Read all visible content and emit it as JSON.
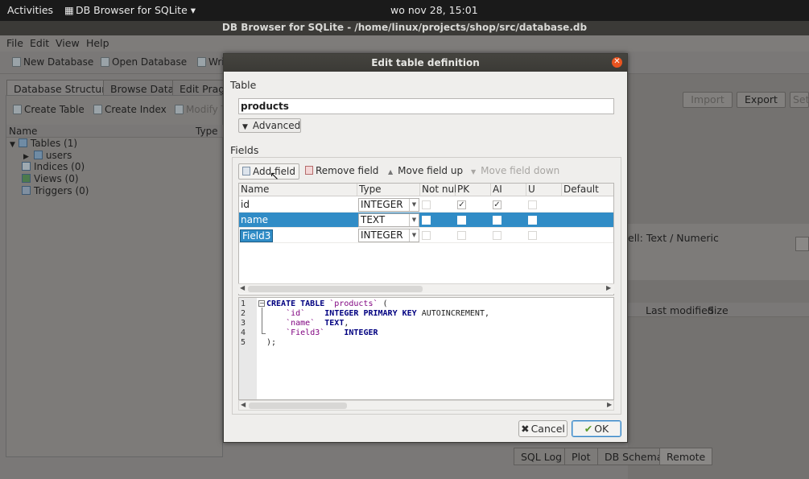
{
  "topbar": {
    "activities": "Activities",
    "app_menu": "DB Browser for SQLite ▾",
    "clock": "wo nov 28, 15:01"
  },
  "window": {
    "title": "DB Browser for SQLite - /home/linux/projects/shop/src/database.db"
  },
  "menubar": {
    "file": "File",
    "edit": "Edit",
    "view": "View",
    "help": "Help"
  },
  "toolbar": {
    "new_db": "New Database",
    "open_db": "Open Database",
    "write": "Wri"
  },
  "main_tabs": {
    "db_structure": "Database Structure",
    "browse_data": "Browse Data",
    "edit_pragmas": "Edit Pragm"
  },
  "left_actions": {
    "create_table": "Create Table",
    "create_index": "Create Index",
    "modify": "Modify T"
  },
  "tree": {
    "col_name": "Name",
    "col_type": "Type",
    "tables": "Tables (1)",
    "users": "users",
    "indices": "Indices (0)",
    "views": "Views (0)",
    "triggers": "Triggers (0)"
  },
  "right": {
    "import": "Import",
    "export": "Export",
    "set": "Set",
    "cell_mode": "ell: Text / Numeric",
    "last_modified": "Last modified",
    "size": "Size",
    "bottom_tabs": [
      "SQL Log",
      "Plot",
      "DB Schema",
      "Remote"
    ]
  },
  "dialog": {
    "title": "Edit table definition",
    "table_label": "Table",
    "table_name": "products",
    "advanced": "Advanced",
    "fields_label": "Fields",
    "add_field": "Add field",
    "remove_field": "Remove field",
    "move_up": "Move field up",
    "move_down": "Move field down",
    "columns": [
      "Name",
      "Type",
      "Not null",
      "PK",
      "AI",
      "U",
      "Default"
    ],
    "rows": [
      {
        "name": "id",
        "type": "INTEGER",
        "not_null": false,
        "pk": true,
        "ai": true,
        "u": false
      },
      {
        "name": "name",
        "type": "TEXT",
        "not_null": false,
        "pk": false,
        "ai": false,
        "u": false
      },
      {
        "name": "Field3",
        "type": "INTEGER",
        "not_null": false,
        "pk": false,
        "ai": false,
        "u": false
      }
    ],
    "sql_line_numbers": [
      "1",
      "2",
      "3",
      "4",
      "5"
    ],
    "sql": {
      "l1_kw": "CREATE TABLE",
      "l1_str": "`products`",
      "l1_rest": " (",
      "l2_str": "`id`",
      "l2_kw": "INTEGER PRIMARY KEY",
      "l2_rest": " AUTOINCREMENT,",
      "l3_str": "`name`",
      "l3_kw": "TEXT",
      "l3_rest": ",",
      "l4_str": "`Field3`",
      "l4_kw": "INTEGER",
      "l5": ");"
    },
    "cancel": "Cancel",
    "ok": "OK"
  }
}
